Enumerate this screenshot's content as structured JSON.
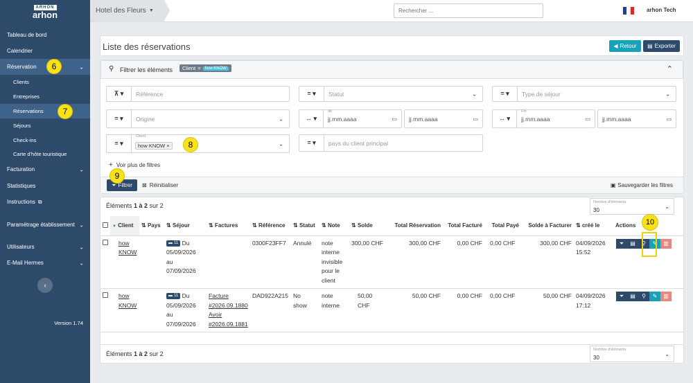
{
  "brand": {
    "logo_top": "ARHON",
    "logo_bottom": "arhon",
    "version": "Version 1.74"
  },
  "sidebar": {
    "items": [
      {
        "label": "Tableau de bord"
      },
      {
        "label": "Calendrier"
      },
      {
        "label": "Réservation"
      },
      {
        "label": "Clients"
      },
      {
        "label": "Entreprises"
      },
      {
        "label": "Réservations"
      },
      {
        "label": "Séjours"
      },
      {
        "label": "Check-ins"
      },
      {
        "label": "Carte d'hôte touristique"
      },
      {
        "label": "Facturation"
      },
      {
        "label": "Statistiques"
      },
      {
        "label": "Instructions"
      },
      {
        "label": "Paramétrage établissement"
      },
      {
        "label": "Utilisateurs"
      },
      {
        "label": "E-Mail Hermes"
      }
    ]
  },
  "topbar": {
    "hotel": "Hotel des Fleurs",
    "search_placeholder": "Rechercher ...",
    "user": "arhon Tech"
  },
  "page": {
    "title": "Liste des réservations",
    "back": "Retour",
    "export": "Exporter"
  },
  "filters": {
    "header": "Filtrer les éléments",
    "chip_label": "Client",
    "chip_value": "how KNOW",
    "reference": "Référence",
    "statut": "Statut",
    "type_sejour": "Type de séjour",
    "origine": "Origine",
    "de": "de",
    "fin": "Fin",
    "date_ph": "jj.mm.aaaa",
    "client_label": "Client",
    "client_tag": "how KNOW",
    "pays": "pays du client principal",
    "more": "Voir plus de filtres",
    "filter_btn": "Filtrer",
    "reset": "Réinitialiser",
    "save": "Sauvegarder les filtres"
  },
  "listing": {
    "count_prefix": "Éléments ",
    "count_range": "1 à 2",
    "count_suffix": " sur 2",
    "per_page_label": "Nombre d'éléments",
    "per_page": "30"
  },
  "table": {
    "headers": [
      "Client",
      "Pays",
      "Séjour",
      "Factures",
      "Référence",
      "Statut",
      "Note",
      "Solde",
      "Total Réservation",
      "Total Facturé",
      "Total Payé",
      "Solde à Facturer",
      "créé le",
      "Actions"
    ],
    "rows": [
      {
        "client1": "how",
        "client2": "KNOW",
        "nights": "11",
        "sej1": "Du",
        "sej2": "05/09/2026",
        "sej3": "au",
        "sej4": "07/09/2026",
        "fact1": "",
        "fact2": "",
        "fact3": "",
        "fact4": "",
        "ref": "0300F23FF7",
        "statut1": "Annulé",
        "statut2": "",
        "note1": "note",
        "note2": "interne",
        "note3": "invisible",
        "note4": "pour le",
        "note5": "client",
        "solde": "300,00 CHF",
        "total": "300,00 CHF",
        "facture": "0,00 CHF",
        "paye": "0,00 CHF",
        "afacturer": "300,00 CHF",
        "cree1": "04/09/2026",
        "cree2": "15:52"
      },
      {
        "client1": "how",
        "client2": "KNOW",
        "nights": "11",
        "sej1": "Du",
        "sej2": "05/09/2026",
        "sej3": "au",
        "sej4": "07/09/2026",
        "fact1": "Facture",
        "fact2": "#2026.09.1880",
        "fact3": "Avoir",
        "fact4": "#2026.09.1881",
        "ref": "DAD922A215",
        "statut1": "No",
        "statut2": "show",
        "note1": "note",
        "note2": "interne",
        "note3": "",
        "note4": "",
        "note5": "",
        "solde": "50,00 CHF",
        "total": "50,00 CHF",
        "facture": "0,00 CHF",
        "paye": "0,00 CHF",
        "afacturer": "50,00 CHF",
        "cree1": "04/09/2026",
        "cree2": "17:12"
      }
    ]
  },
  "callouts": {
    "c6": "6",
    "c7": "7",
    "c8": "8",
    "c9": "9",
    "c10": "10"
  }
}
